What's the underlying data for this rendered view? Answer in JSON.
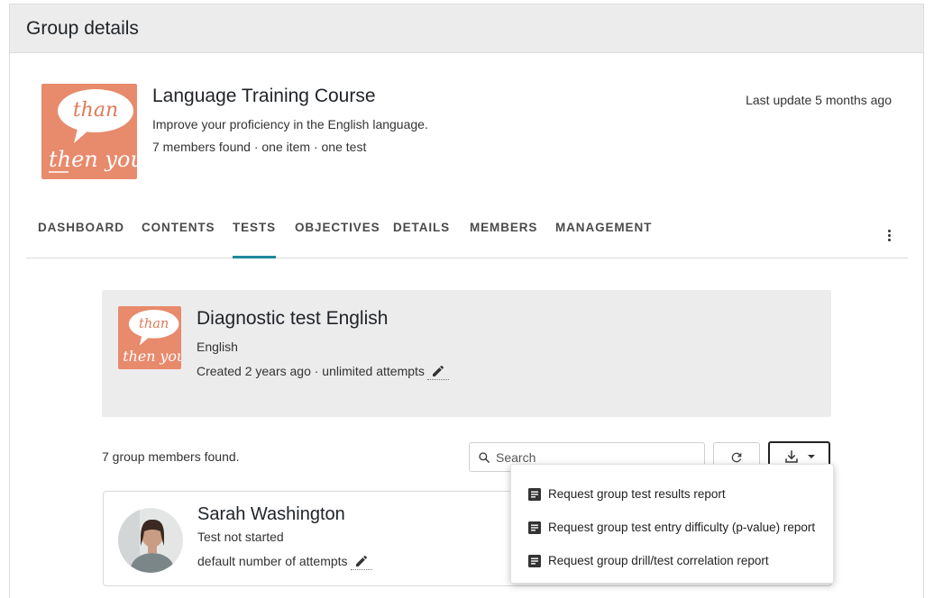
{
  "panel": {
    "title": "Group details"
  },
  "course": {
    "title": "Language Training Course",
    "description": "Improve your proficiency in the English language.",
    "meta": "7 members found · one item · one test",
    "last_update": "Last update 5 months ago",
    "thumbnail_words": [
      "than",
      "then you"
    ]
  },
  "tabs": [
    {
      "label": "DASHBOARD"
    },
    {
      "label": "CONTENTS"
    },
    {
      "label": "TESTS"
    },
    {
      "label": "OBJECTIVES"
    },
    {
      "label": "DETAILS"
    },
    {
      "label": "MEMBERS"
    },
    {
      "label": "MANAGEMENT"
    }
  ],
  "active_tab": "TESTS",
  "test": {
    "title": "Diagnostic test English",
    "language": "English",
    "meta": "Created 2 years ago · unlimited attempts"
  },
  "members": {
    "count_text": "7 group members found.",
    "search_placeholder": "Search",
    "list": [
      {
        "name": "Sarah Washington",
        "status": "Test not started",
        "attempts": "default number of attempts"
      }
    ]
  },
  "download_menu": {
    "items": [
      {
        "label": "Request group test results report"
      },
      {
        "label": "Request group test entry difficulty (p-value) report"
      },
      {
        "label": "Request group drill/test correlation report"
      }
    ]
  },
  "colors": {
    "accent": "#1f8a9a",
    "thumbnail_bg": "#e88a6c",
    "header_bg": "#ececec"
  },
  "icons": [
    "search-icon",
    "refresh-icon",
    "download-icon",
    "caret-down-icon",
    "edit-icon",
    "kebab-icon",
    "document-icon"
  ]
}
